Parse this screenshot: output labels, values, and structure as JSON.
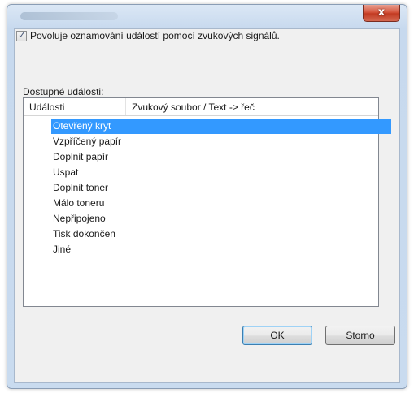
{
  "dialog": {
    "close_label": "x"
  },
  "options": {
    "enable_label": "Povoluje oznamování událostí pomocí zvukových signálů.",
    "enable_checked": true
  },
  "events": {
    "section_label": "Dostupné události:",
    "columns": [
      "Události",
      "Zvukový soubor / Text -> řeč"
    ],
    "rows": [
      "Otevřený kryt",
      "Vzpříčený papír",
      "Doplnit papír",
      "Uspat",
      "Doplnit toner",
      "Málo toneru",
      "Nepřipojeno",
      "Tisk dokončen",
      "Jiné"
    ],
    "selected_index": 0
  },
  "buttons": {
    "ok_label": "OK",
    "cancel_label": "Storno"
  },
  "colors": {
    "selection": "#3399ff",
    "close_button": "#c23a22"
  }
}
